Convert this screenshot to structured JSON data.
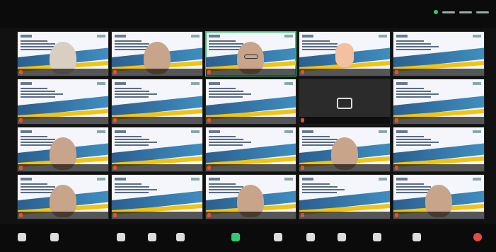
{
  "meeting": {
    "tiles": [
      {
        "type": "slide",
        "has_person": "hijab"
      },
      {
        "type": "slide",
        "has_person": "person"
      },
      {
        "type": "slide",
        "has_person": "glasses",
        "active": true
      },
      {
        "type": "slide",
        "has_person": "avatar"
      },
      {
        "type": "slide"
      },
      {
        "type": "slide"
      },
      {
        "type": "slide"
      },
      {
        "type": "slide"
      },
      {
        "type": "blank",
        "has_person": "cam"
      },
      {
        "type": "slide"
      },
      {
        "type": "slide",
        "has_person": "person"
      },
      {
        "type": "slide"
      },
      {
        "type": "slide"
      },
      {
        "type": "slide",
        "has_person": "person"
      },
      {
        "type": "slide"
      },
      {
        "type": "slide",
        "has_person": "person"
      },
      {
        "type": "slide"
      },
      {
        "type": "slide",
        "has_person": "person"
      },
      {
        "type": "slide"
      },
      {
        "type": "slide",
        "has_person": "person"
      }
    ]
  },
  "toolbar": {
    "items": [
      {
        "icon": "mic-icon"
      },
      {
        "icon": "video-icon"
      },
      {
        "icon": "security-icon"
      },
      {
        "icon": "participants-icon"
      },
      {
        "icon": "chat-icon"
      },
      {
        "icon": "share-screen-icon",
        "accent": "green"
      },
      {
        "icon": "reactions-icon"
      },
      {
        "icon": "apps-icon"
      },
      {
        "icon": "whiteboards-icon"
      },
      {
        "icon": "notes-icon"
      },
      {
        "icon": "more-icon"
      },
      {
        "icon": "end-icon",
        "accent": "red"
      }
    ]
  },
  "colors": {
    "background": "#111111",
    "active_border": "#2ecc71",
    "slide_wave": "#2b5f8f",
    "slide_stripe": "#f1c40f"
  }
}
